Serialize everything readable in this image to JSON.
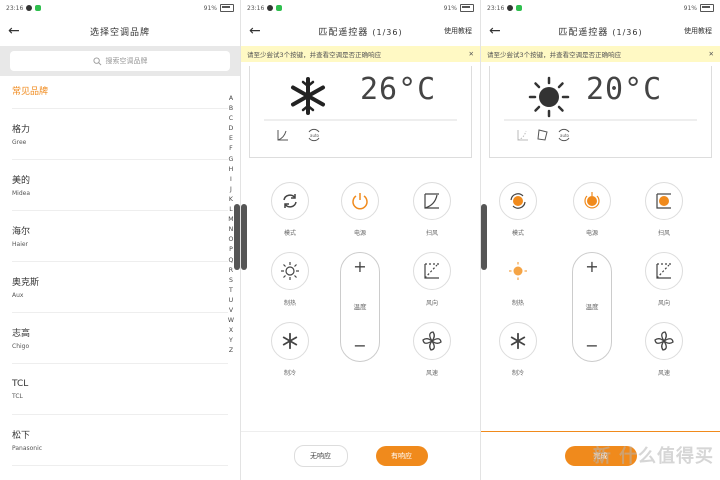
{
  "status_bar": {
    "time": "23:16",
    "battery": "91%"
  },
  "screen1": {
    "title": "选择空调品牌",
    "search_placeholder": "搜索空调品牌",
    "section": "常见品牌",
    "brands": [
      {
        "cn": "格力",
        "en": "Gree"
      },
      {
        "cn": "美的",
        "en": "Midea"
      },
      {
        "cn": "海尔",
        "en": "Haier"
      },
      {
        "cn": "奥克斯",
        "en": "Aux"
      },
      {
        "cn": "志高",
        "en": "Chigo"
      },
      {
        "cn": "TCL",
        "en": "TCL"
      },
      {
        "cn": "松下",
        "en": "Panasonic"
      }
    ],
    "alphabet": [
      "A",
      "B",
      "C",
      "D",
      "E",
      "F",
      "G",
      "H",
      "I",
      "J",
      "K",
      "L",
      "M",
      "N",
      "O",
      "P",
      "Q",
      "R",
      "S",
      "T",
      "U",
      "V",
      "W",
      "X",
      "Y",
      "Z"
    ]
  },
  "screen2": {
    "title": "匹配遥控器",
    "count": "(1/36)",
    "help": "使用教程",
    "banner": "请至少尝试3个按键，并查看空调是否正确响应",
    "temperature": "26°C",
    "mode_icon": "snowflake-icon",
    "buttons": {
      "mode": "模式",
      "power": "电源",
      "sweep": "扫风",
      "heat": "制热",
      "direction": "风向",
      "cool": "制冷",
      "speed": "风速",
      "temp": "温度"
    },
    "no_response": "无响应",
    "has_response": "有响应"
  },
  "screen3": {
    "title": "匹配遥控器",
    "count": "(1/36)",
    "help": "使用教程",
    "banner": "请至少尝试3个按键，并查看空调是否正确响应",
    "temperature": "20°C",
    "mode_icon": "sun-icon",
    "buttons": {
      "mode": "模式",
      "power": "电源",
      "sweep": "扫风",
      "heat": "制热",
      "direction": "风向",
      "cool": "制冷",
      "speed": "风速",
      "temp": "温度"
    },
    "done": "完成",
    "watermark": "新 什么值得买"
  },
  "colors": {
    "accent": "#f08a1c",
    "banner": "#fff9c4"
  }
}
